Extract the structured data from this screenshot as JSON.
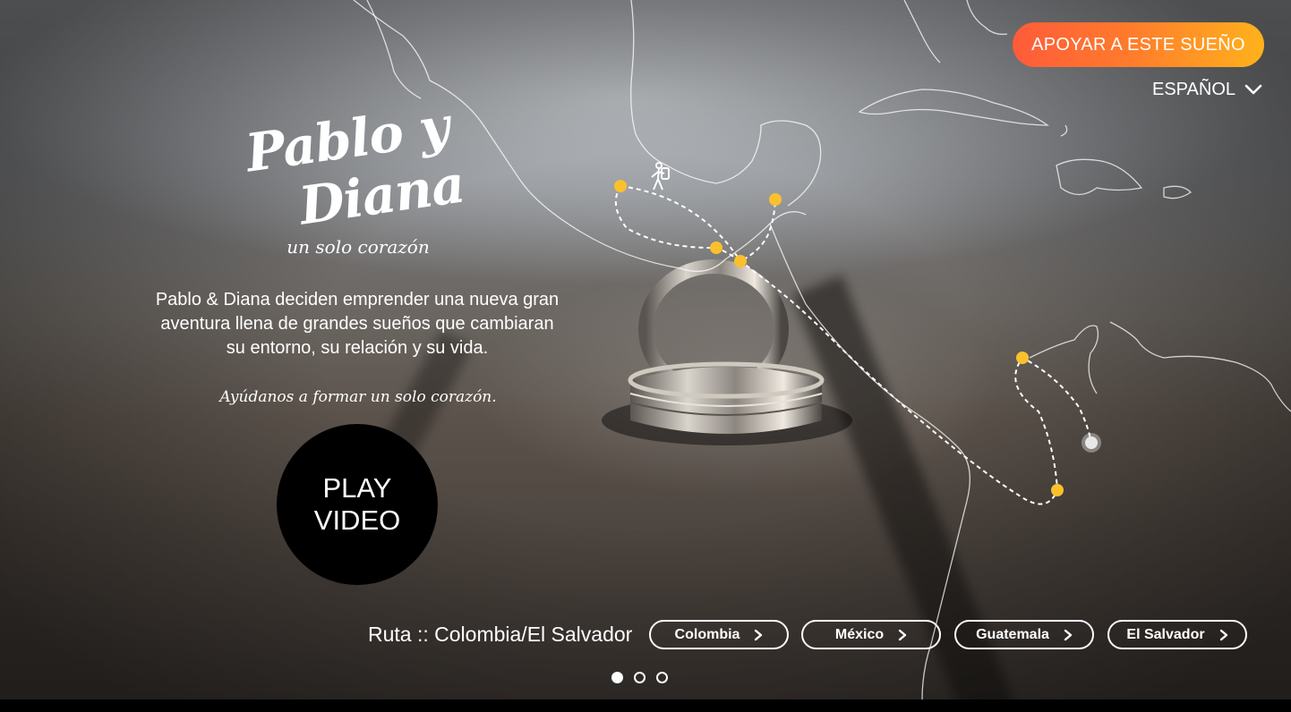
{
  "header": {
    "cta_label": "APOYAR A ESTE SUEÑO",
    "language_label": "ESPAÑOL"
  },
  "hero": {
    "logo_line1": "Pablo y",
    "logo_line2": "Diana",
    "tagline": "un solo corazón",
    "description_lines": [
      "Pablo & Diana deciden emprender una nueva gran",
      "aventura llena de grandes sueños que cambiaran",
      "su entorno, su relación y su vida."
    ],
    "call_to_action": "Ayúdanos a formar un solo corazón.",
    "play_line1": "PLAY",
    "play_line2": "VIDEO"
  },
  "route": {
    "label": "Ruta :: Colombia/El Salvador",
    "stops": [
      "Colombia",
      "México",
      "Guatemala",
      "El Salvador"
    ]
  },
  "carousel": {
    "total_slides": 3,
    "active_slide": 1
  },
  "colors": {
    "accent_start": "#ff5b3a",
    "accent_end": "#ffb21c",
    "route_marker": "#fbc02d"
  }
}
